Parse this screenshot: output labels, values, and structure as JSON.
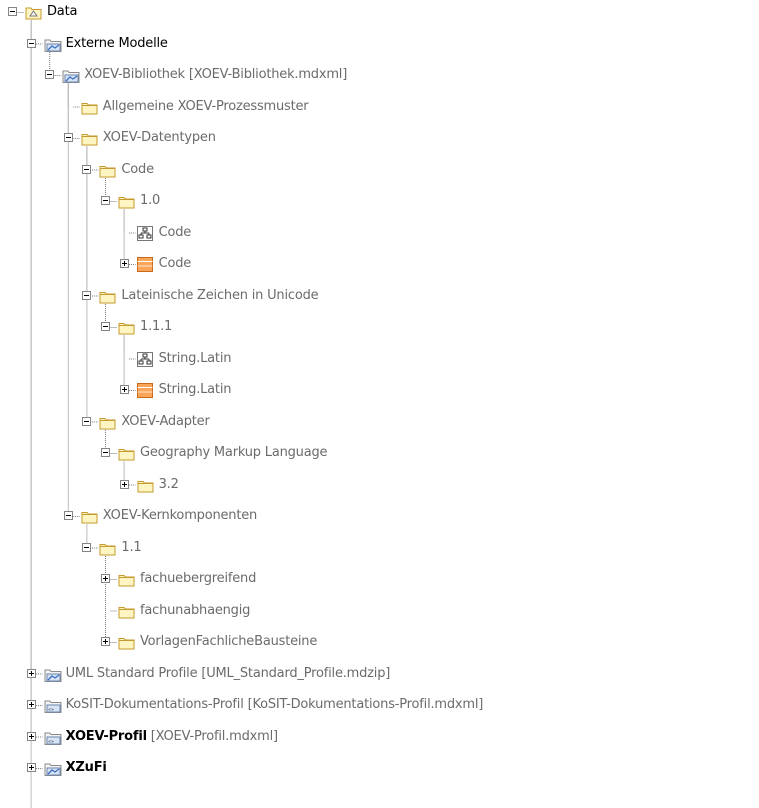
{
  "colors": {
    "folder_fill": "#fff5c2",
    "folder_stroke": "#c59a2c",
    "gray_text": "#6b6b6b",
    "dotted_line": "#7a7a7a",
    "enum_fill": "#f9a65a"
  },
  "tree": [
    {
      "label": "Data",
      "suffix": "",
      "level": 0,
      "expander": "minus",
      "icon": "package",
      "style": "dark",
      "bold": false
    },
    {
      "label": "Externe Modelle",
      "suffix": "",
      "level": 1,
      "expander": "minus",
      "icon": "model-package",
      "style": "dark",
      "bold": false
    },
    {
      "label": "XOEV-Bibliothek [XOEV-Bibliothek.mdxml]",
      "suffix": "",
      "level": 2,
      "expander": "minus",
      "icon": "model-package",
      "style": "gray",
      "bold": false
    },
    {
      "label": "Allgemeine XOEV-Prozessmuster",
      "suffix": "",
      "level": 3,
      "expander": "none",
      "icon": "folder",
      "style": "gray",
      "bold": false
    },
    {
      "label": "XOEV-Datentypen",
      "suffix": "",
      "level": 3,
      "expander": "minus",
      "icon": "folder",
      "style": "gray",
      "bold": false
    },
    {
      "label": "Code",
      "suffix": "",
      "level": 4,
      "expander": "minus",
      "icon": "folder",
      "style": "gray",
      "bold": false
    },
    {
      "label": "1.0",
      "suffix": "",
      "level": 5,
      "expander": "minus",
      "icon": "folder",
      "style": "gray",
      "bold": false
    },
    {
      "label": "Code",
      "suffix": "",
      "level": 6,
      "expander": "none",
      "icon": "diagram",
      "style": "gray",
      "bold": false
    },
    {
      "label": "Code",
      "suffix": "",
      "level": 6,
      "expander": "plus",
      "icon": "enumeration",
      "style": "gray",
      "bold": false
    },
    {
      "label": "Lateinische Zeichen in Unicode",
      "suffix": "",
      "level": 4,
      "expander": "minus",
      "icon": "folder",
      "style": "gray",
      "bold": false
    },
    {
      "label": "1.1.1",
      "suffix": "",
      "level": 5,
      "expander": "minus",
      "icon": "folder",
      "style": "gray",
      "bold": false
    },
    {
      "label": "String.Latin",
      "suffix": "",
      "level": 6,
      "expander": "none",
      "icon": "diagram",
      "style": "gray",
      "bold": false
    },
    {
      "label": "String.Latin",
      "suffix": "",
      "level": 6,
      "expander": "plus",
      "icon": "enumeration",
      "style": "gray",
      "bold": false
    },
    {
      "label": "XOEV-Adapter",
      "suffix": "",
      "level": 4,
      "expander": "minus",
      "icon": "folder",
      "style": "gray",
      "bold": false
    },
    {
      "label": "Geography Markup Language",
      "suffix": "",
      "level": 5,
      "expander": "minus",
      "icon": "folder",
      "style": "gray",
      "bold": false
    },
    {
      "label": "3.2",
      "suffix": "",
      "level": 6,
      "expander": "plus",
      "icon": "folder",
      "style": "gray",
      "bold": false
    },
    {
      "label": "XOEV-Kernkomponenten",
      "suffix": "",
      "level": 3,
      "expander": "minus",
      "icon": "folder",
      "style": "gray",
      "bold": false
    },
    {
      "label": "1.1",
      "suffix": "",
      "level": 4,
      "expander": "minus",
      "icon": "folder",
      "style": "gray",
      "bold": false
    },
    {
      "label": "fachuebergreifend",
      "suffix": "",
      "level": 5,
      "expander": "plus",
      "icon": "folder",
      "style": "gray",
      "bold": false
    },
    {
      "label": "fachunabhaengig",
      "suffix": "",
      "level": 5,
      "expander": "none",
      "icon": "folder",
      "style": "gray",
      "bold": false
    },
    {
      "label": "VorlagenFachlicheBausteine",
      "suffix": "",
      "level": 5,
      "expander": "plus",
      "icon": "folder",
      "style": "gray",
      "bold": false
    },
    {
      "label": "UML Standard Profile [UML_Standard_Profile.mdzip]",
      "suffix": "",
      "level": 1,
      "expander": "plus",
      "icon": "model-package",
      "style": "gray",
      "bold": false
    },
    {
      "label": "KoSIT-Dokumentations-Profil [KoSIT-Dokumentations-Profil.mdxml]",
      "suffix": "",
      "level": 1,
      "expander": "plus",
      "icon": "profile-package",
      "style": "gray",
      "bold": false
    },
    {
      "label": "XOEV-Profil",
      "suffix": " [XOEV-Profil.mdxml]",
      "level": 1,
      "expander": "plus",
      "icon": "profile-package",
      "style": "dark",
      "bold": true
    },
    {
      "label": "XZuFi",
      "suffix": "",
      "level": 1,
      "expander": "plus",
      "icon": "model-package",
      "style": "dark",
      "bold": true
    }
  ]
}
